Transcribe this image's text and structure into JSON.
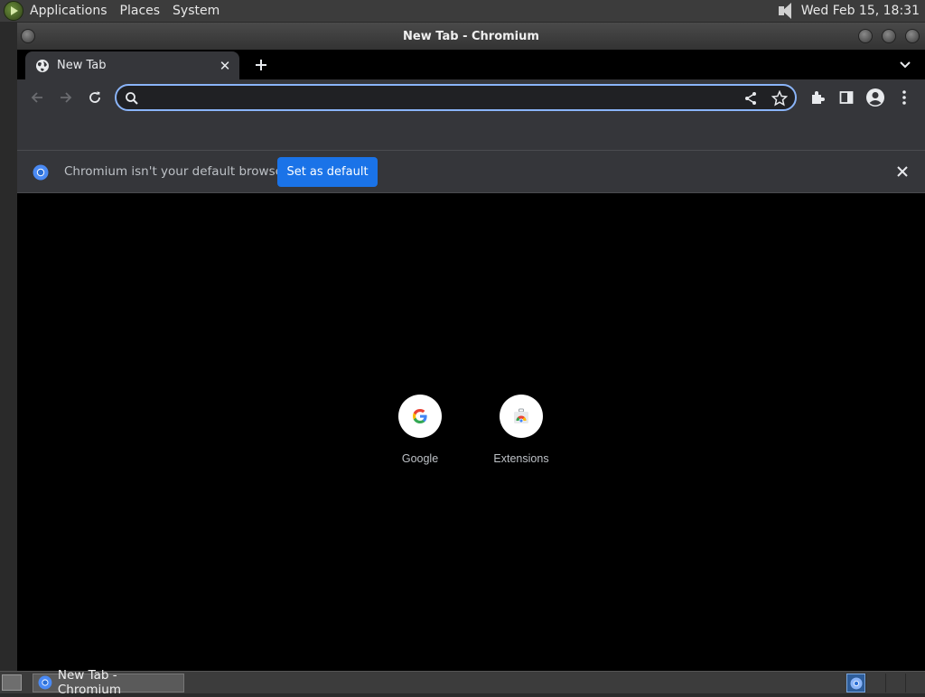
{
  "top_panel": {
    "menus": [
      "Applications",
      "Places",
      "System"
    ],
    "clock": "Wed Feb 15, 18:31"
  },
  "window": {
    "title": "New Tab - Chromium"
  },
  "tab": {
    "title": "New Tab"
  },
  "omnibox": {
    "value": "",
    "placeholder": ""
  },
  "infobar": {
    "message": "Chromium isn't your default browser",
    "button_label": "Set as default"
  },
  "shortcuts": [
    {
      "label": "Google"
    },
    {
      "label": "Extensions"
    }
  ],
  "taskbar": {
    "task_label": "New Tab - Chromium"
  },
  "colors": {
    "accent": "#8ab4f8",
    "primary_button": "#1a73e8",
    "toolbar_bg": "#35363a",
    "content_bg": "#000000"
  }
}
